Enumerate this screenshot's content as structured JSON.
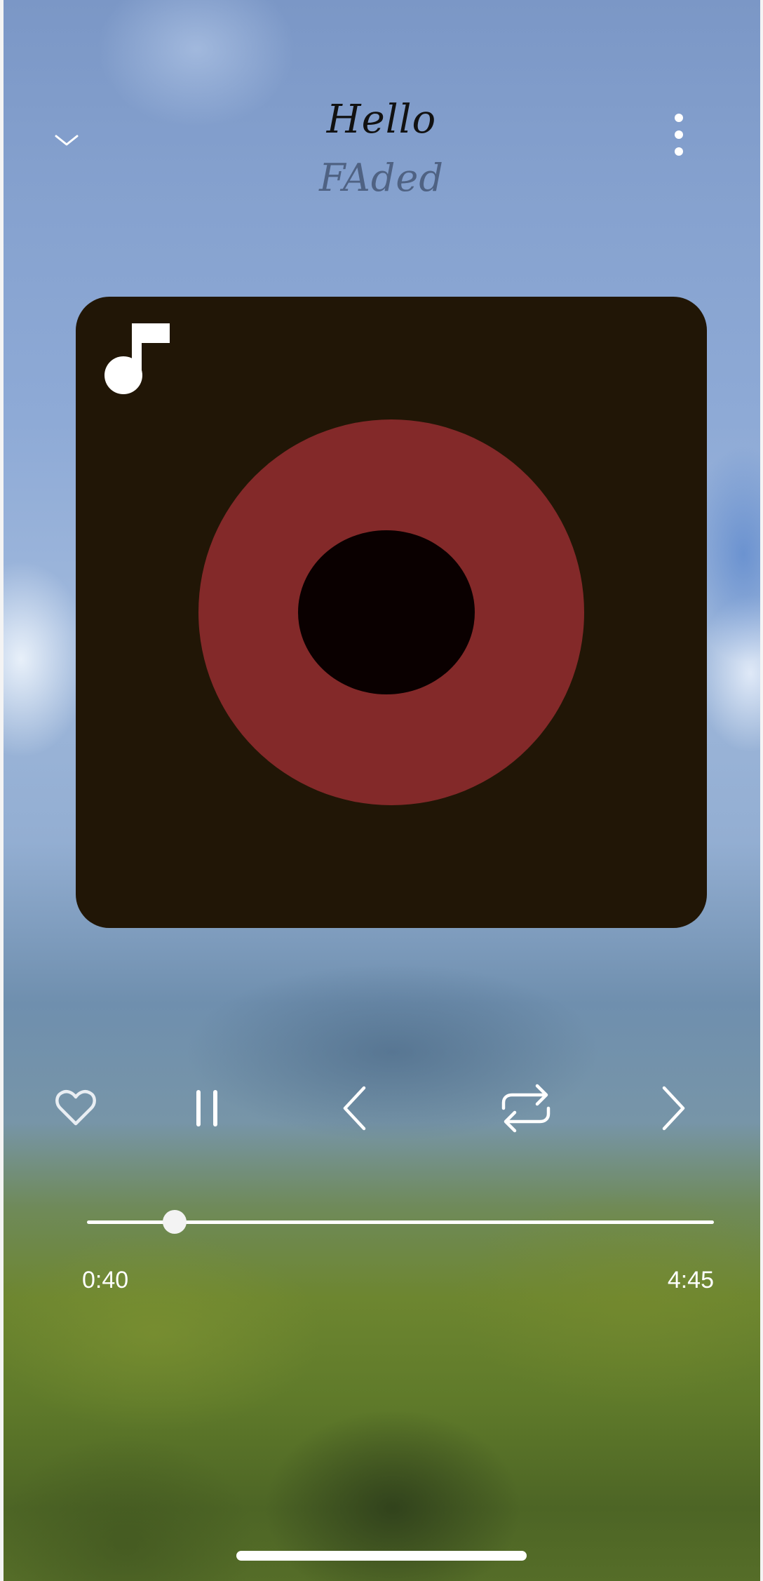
{
  "player": {
    "title": "Hello",
    "artist": "FAded",
    "icons": {
      "collapse": "chevron-down-icon",
      "menu": "more-vertical-icon",
      "album_placeholder": "music-note-icon"
    },
    "colors": {
      "album_bg": "#211606",
      "disc_ring": "#832929",
      "disc_hole": "#0a0000",
      "icon": "#ffffff"
    }
  },
  "controls": [
    {
      "name": "favorite",
      "icon": "heart-icon"
    },
    {
      "name": "pause",
      "icon": "pause-icon"
    },
    {
      "name": "previous",
      "icon": "chevron-left-icon"
    },
    {
      "name": "repeat",
      "icon": "repeat-icon"
    },
    {
      "name": "next",
      "icon": "chevron-right-icon"
    }
  ],
  "progress": {
    "elapsed": "0:40",
    "total": "4:45",
    "fraction": 0.14
  }
}
